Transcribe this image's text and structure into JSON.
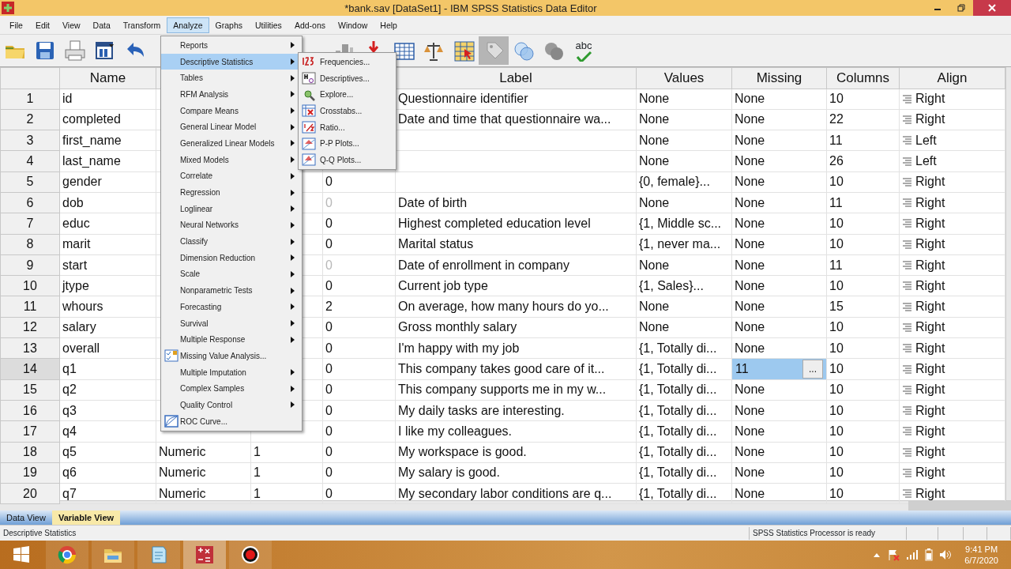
{
  "window": {
    "title": "*bank.sav [DataSet1] - IBM SPSS Statistics Data Editor"
  },
  "menu_bar": [
    {
      "label": "File",
      "selected": false
    },
    {
      "label": "Edit",
      "selected": false
    },
    {
      "label": "View",
      "selected": false
    },
    {
      "label": "Data",
      "selected": false
    },
    {
      "label": "Transform",
      "selected": false
    },
    {
      "label": "Analyze",
      "selected": true
    },
    {
      "label": "Graphs",
      "selected": false
    },
    {
      "label": "Utilities",
      "selected": false
    },
    {
      "label": "Add-ons",
      "selected": false
    },
    {
      "label": "Window",
      "selected": false
    },
    {
      "label": "Help",
      "selected": false
    }
  ],
  "toolbar": [
    [
      {
        "kind": "open"
      },
      {
        "kind": "save"
      },
      {
        "kind": "print"
      },
      {
        "kind": "recall"
      },
      {
        "kind": "undo"
      }
    ],
    [
      {
        "kind": "chart"
      },
      {
        "kind": "insert"
      },
      {
        "kind": "grid"
      },
      {
        "kind": "scales"
      },
      {
        "kind": "pick"
      },
      {
        "kind": "tag"
      },
      {
        "kind": "venn"
      },
      {
        "kind": "circles"
      },
      {
        "kind": "spell",
        "text": "abc"
      }
    ]
  ],
  "analyze_menu": [
    {
      "label": "Reports",
      "kind": "submenu",
      "selected": false
    },
    {
      "label": "Descriptive Statistics",
      "kind": "submenu",
      "selected": true
    },
    {
      "label": "Tables",
      "kind": "submenu",
      "selected": false
    },
    {
      "label": "RFM Analysis",
      "kind": "submenu",
      "selected": false
    },
    {
      "label": "Compare Means",
      "kind": "submenu",
      "selected": false
    },
    {
      "label": "General Linear Model",
      "kind": "submenu",
      "selected": false
    },
    {
      "label": "Generalized Linear Models",
      "kind": "submenu",
      "selected": false
    },
    {
      "label": "Mixed Models",
      "kind": "submenu",
      "selected": false
    },
    {
      "label": "Correlate",
      "kind": "submenu",
      "selected": false
    },
    {
      "label": "Regression",
      "kind": "submenu",
      "selected": false
    },
    {
      "label": "Loglinear",
      "kind": "submenu",
      "selected": false
    },
    {
      "label": "Neural Networks",
      "kind": "submenu",
      "selected": false
    },
    {
      "label": "Classify",
      "kind": "submenu",
      "selected": false
    },
    {
      "label": "Dimension Reduction",
      "kind": "submenu",
      "selected": false
    },
    {
      "label": "Scale",
      "kind": "submenu",
      "selected": false
    },
    {
      "label": "Nonparametric Tests",
      "kind": "submenu",
      "selected": false
    },
    {
      "label": "Forecasting",
      "kind": "submenu",
      "selected": false
    },
    {
      "label": "Survival",
      "kind": "submenu",
      "selected": false
    },
    {
      "label": "Multiple Response",
      "kind": "submenu",
      "selected": false
    },
    {
      "label": "Missing Value Analysis...",
      "kind": "checklist",
      "selected": false
    },
    {
      "label": "Multiple Imputation",
      "kind": "submenu",
      "selected": false
    },
    {
      "label": "Complex Samples",
      "kind": "submenu",
      "selected": false
    },
    {
      "label": "Quality Control",
      "kind": "submenu",
      "selected": false
    },
    {
      "label": "ROC Curve...",
      "kind": "curve",
      "selected": false
    }
  ],
  "descriptive_submenu": [
    {
      "label": "Frequencies...",
      "kind": "frequencies"
    },
    {
      "label": "Descriptives...",
      "kind": "descriptives"
    },
    {
      "label": "Explore...",
      "kind": "explore"
    },
    {
      "label": "Crosstabs...",
      "kind": "crosstabs"
    },
    {
      "label": "Ratio...",
      "kind": "ratio"
    },
    {
      "label": "P-P Plots...",
      "kind": "ppplot"
    },
    {
      "label": "Q-Q Plots...",
      "kind": "qqplot"
    }
  ],
  "grid": {
    "columns": [
      "Name",
      null,
      null,
      null,
      "Label",
      "Values",
      "Missing",
      "Columns",
      "Align"
    ],
    "rows": [
      {
        "num": "1",
        "selected": false,
        "cells": [
          "id",
          null,
          null,
          null,
          "Questionnaire identifier",
          "None",
          "None",
          "10",
          "Right"
        ]
      },
      {
        "num": "2",
        "selected": false,
        "cells": [
          "completed",
          null,
          null,
          null,
          "Date and time that questionnaire wa...",
          "None",
          "None",
          "22",
          "Right"
        ]
      },
      {
        "num": "3",
        "selected": false,
        "cells": [
          "first_name",
          null,
          null,
          null,
          null,
          "None",
          "None",
          "11",
          "Left"
        ]
      },
      {
        "num": "4",
        "selected": false,
        "cells": [
          "last_name",
          null,
          null,
          null,
          null,
          "None",
          "None",
          "26",
          "Left"
        ]
      },
      {
        "num": "5",
        "selected": false,
        "greyed_decimals": false,
        "cells": [
          "gender",
          null,
          null,
          "0",
          null,
          "{0, female}...",
          "None",
          "10",
          "Right"
        ]
      },
      {
        "num": "6",
        "selected": false,
        "greyed_decimals": true,
        "cells": [
          "dob",
          null,
          null,
          "0",
          "Date of birth",
          "None",
          "None",
          "11",
          "Right"
        ]
      },
      {
        "num": "7",
        "selected": false,
        "greyed_decimals": false,
        "cells": [
          "educ",
          null,
          null,
          "0",
          "Highest completed education level",
          "{1, Middle sc...",
          "None",
          "10",
          "Right"
        ]
      },
      {
        "num": "8",
        "selected": false,
        "greyed_decimals": false,
        "cells": [
          "marit",
          null,
          null,
          "0",
          "Marital status",
          "{1, never ma...",
          "None",
          "10",
          "Right"
        ]
      },
      {
        "num": "9",
        "selected": false,
        "greyed_decimals": true,
        "cells": [
          "start",
          null,
          null,
          "0",
          "Date of enrollment in company",
          "None",
          "None",
          "11",
          "Right"
        ]
      },
      {
        "num": "10",
        "selected": false,
        "greyed_decimals": false,
        "cells": [
          "jtype",
          null,
          null,
          "0",
          "Current job type",
          "{1, Sales}...",
          "None",
          "10",
          "Right"
        ]
      },
      {
        "num": "11",
        "selected": false,
        "greyed_decimals": false,
        "cells": [
          "whours",
          null,
          null,
          "2",
          "On average, how many hours do yo...",
          "None",
          "None",
          "15",
          "Right"
        ]
      },
      {
        "num": "12",
        "selected": false,
        "greyed_decimals": false,
        "cells": [
          "salary",
          null,
          null,
          "0",
          "Gross monthly salary",
          "None",
          "None",
          "10",
          "Right"
        ]
      },
      {
        "num": "13",
        "selected": false,
        "greyed_decimals": false,
        "cells": [
          "overall",
          null,
          null,
          "0",
          "I'm happy with my job",
          "{1, Totally di...",
          "None",
          "10",
          "Right"
        ]
      },
      {
        "num": "14",
        "selected": true,
        "greyed_decimals": false,
        "cells": [
          "q1",
          null,
          null,
          "0",
          "This company takes good care of it...",
          "{1, Totally di...",
          {
            "text": "11",
            "editing": true,
            "button": "..."
          },
          "10",
          "Right"
        ]
      },
      {
        "num": "15",
        "selected": false,
        "greyed_decimals": false,
        "cells": [
          "q2",
          null,
          null,
          "0",
          "This company supports me in my w...",
          "{1, Totally di...",
          "None",
          "10",
          "Right"
        ]
      },
      {
        "num": "16",
        "selected": false,
        "greyed_decimals": false,
        "cells": [
          "q3",
          null,
          null,
          "0",
          "My daily tasks are interesting.",
          "{1, Totally di...",
          "None",
          "10",
          "Right"
        ]
      },
      {
        "num": "17",
        "selected": false,
        "greyed_decimals": false,
        "cells": [
          "q4",
          null,
          null,
          "0",
          "I like my colleagues.",
          "{1, Totally di...",
          "None",
          "10",
          "Right"
        ]
      },
      {
        "num": "18",
        "selected": false,
        "greyed_decimals": false,
        "cells": [
          "q5",
          "Numeric",
          "1",
          "0",
          "My workspace is good.",
          "{1, Totally di...",
          "None",
          "10",
          "Right"
        ]
      },
      {
        "num": "19",
        "selected": false,
        "greyed_decimals": false,
        "cells": [
          "q6",
          "Numeric",
          "1",
          "0",
          "My salary is good.",
          "{1, Totally di...",
          "None",
          "10",
          "Right"
        ]
      },
      {
        "num": "20",
        "selected": false,
        "greyed_decimals": false,
        "cells": [
          "q7",
          "Numeric",
          "1",
          "0",
          "My secondary labor conditions are q...",
          "{1, Totally di...",
          "None",
          "10",
          "Right"
        ]
      }
    ]
  },
  "sheet_tabs": [
    {
      "label": "Data View",
      "selected": false
    },
    {
      "label": "Variable View",
      "selected": true
    }
  ],
  "status_bar": {
    "message": "Descriptive Statistics",
    "processor": "SPSS Statistics  Processor is ready"
  },
  "taskbar": {
    "apps": [
      {
        "kind": "browser",
        "selected": false
      },
      {
        "kind": "folder",
        "selected": false
      },
      {
        "kind": "notepad",
        "selected": false
      },
      {
        "kind": "stats",
        "selected": true
      },
      {
        "kind": "record",
        "selected": false
      }
    ],
    "time": "9:41 PM",
    "date": "6/7/2020"
  }
}
